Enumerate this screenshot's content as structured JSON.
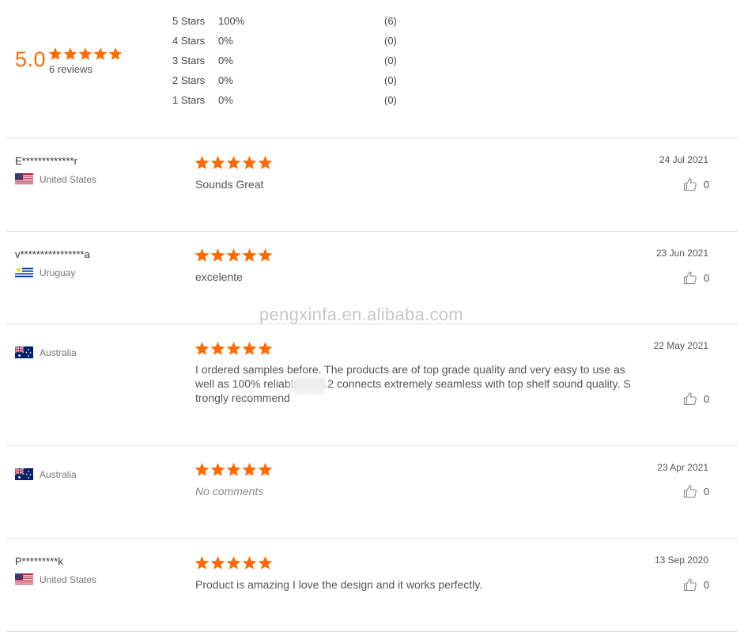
{
  "summary": {
    "average": "5.0",
    "reviews_label": "6 reviews",
    "star_color": "#ff6a00",
    "distribution": [
      {
        "label": "5 Stars",
        "percent": "100%",
        "count": "(6)"
      },
      {
        "label": "4 Stars",
        "percent": "0%",
        "count": "(0)"
      },
      {
        "label": "3 Stars",
        "percent": "0%",
        "count": "(0)"
      },
      {
        "label": "2 Stars",
        "percent": "0%",
        "count": "(0)"
      },
      {
        "label": "1 Stars",
        "percent": "0%",
        "count": "(0)"
      }
    ]
  },
  "reviews": [
    {
      "name": "E*************r",
      "country": "United States",
      "flag": "us-flag-icon",
      "rating": 5,
      "text": "Sounds Great",
      "date": "24 Jul 2021",
      "likes": "0"
    },
    {
      "name": "v****************a",
      "country": "Uruguay",
      "flag": "uruguay-flag-icon",
      "rating": 5,
      "text": "excelente",
      "date": "23 Jun 2021",
      "likes": "0"
    },
    {
      "name": "",
      "country": "Australia",
      "flag": "australia-flag-icon",
      "rating": 5,
      "text": "I ordered samples before. The products are of top grade quality and very easy to use as well as 100% reliable. Bl          5.2 connects extremely seamless with top shelf sound quality. S trongly recommend",
      "date": "22 May 2021",
      "likes": "0"
    },
    {
      "name": "",
      "country": "Australia",
      "flag": "australia-flag-icon",
      "rating": 5,
      "text": "No comments",
      "date": "23 Apr 2021",
      "likes": "0"
    },
    {
      "name": "P*********k",
      "country": "United States",
      "flag": "us-flag-icon",
      "rating": 5,
      "text": "Product is amazing I love the design and it works perfectly.",
      "date": "13 Sep 2020",
      "likes": "0"
    }
  ],
  "watermark": "pengxinfa.en.alibaba.com"
}
